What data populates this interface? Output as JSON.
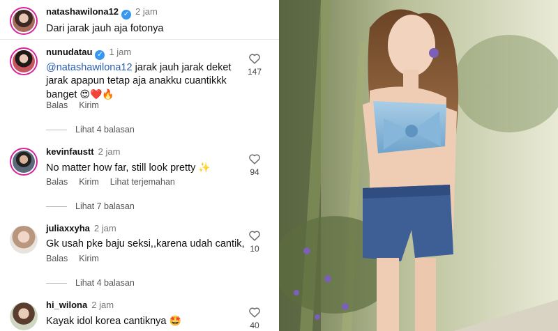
{
  "comments": [
    {
      "username": "natashawilona12",
      "time": "2 jam",
      "text": "Dari jarak jauh aja fotonya"
    },
    {
      "username": "nunudatau",
      "time": "1 jam",
      "mention": "@natashawilona12",
      "text": " jarak jauh jarak deket jarak apapun tetap aja anakku cuantikkk banget",
      "emoji": "😍❤️🔥",
      "likes": "147",
      "reply": "Balas",
      "send": "Kirim",
      "view_replies": "Lihat 4 balasan"
    },
    {
      "username": "kevinfaustt",
      "time": "2 jam",
      "text": "No matter how far, still look pretty",
      "emoji": "✨",
      "likes": "94",
      "reply": "Balas",
      "send": "Kirim",
      "translate": "Lihat terjemahan",
      "view_replies": "Lihat 7 balasan"
    },
    {
      "username": "juliaxxyha",
      "time": "2 jam",
      "text": "Gk usah pke baju seksi,,karena udah cantik,",
      "likes": "10",
      "reply": "Balas",
      "send": "Kirim",
      "view_replies": "Lihat 4 balasan"
    },
    {
      "username": "hi_wilona",
      "time": "2 jam",
      "text": "Kayak idol korea cantiknya",
      "emoji": "🤩",
      "likes": "40"
    }
  ],
  "colors": {
    "accent": "#3897f0",
    "mention": "#2a5db0",
    "ring": "#d6249f"
  },
  "icons": {
    "like": "heart-outline-icon",
    "verified": "verified-badge-icon"
  }
}
